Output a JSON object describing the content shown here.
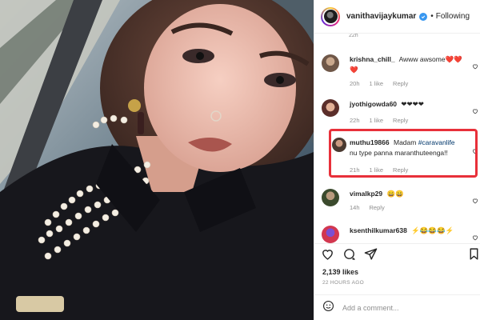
{
  "post": {
    "username": "vanithavijaykumar",
    "follow_status": "Following",
    "separator": "•",
    "likes": "2,139 likes",
    "time_ago": "22 HOURS AGO"
  },
  "comments_partial_meta": "22h",
  "comments": [
    {
      "user": "krishna_chill_",
      "text": "Awww awsome❤️❤️❤️",
      "time": "20h",
      "likes": "1 like",
      "reply": "Reply"
    },
    {
      "user": "jyothigowda60",
      "text": "❤❤❤❤",
      "time": "22h",
      "likes": "1 like",
      "reply": "Reply"
    },
    {
      "user": "muthu19866",
      "text_before": "Madam",
      "hashtag": "#caravanlife",
      "text_after": "nu type panna maranthuteenga!!",
      "time": "21h",
      "likes": "1 like",
      "reply": "Reply"
    },
    {
      "user": "vimalkp29",
      "text": "😄😄",
      "time": "14h",
      "reply": "Reply"
    },
    {
      "user": "ksenthilkumar638",
      "text": "⚡😂😂😂⚡"
    }
  ],
  "add_comment": {
    "placeholder": "Add a comment..."
  },
  "colors": {
    "highlight": "#e8303a",
    "link": "#00376b",
    "verified": "#3897f0"
  },
  "icons": [
    "heart-icon",
    "comment-icon",
    "share-icon",
    "bookmark-icon",
    "emoji-icon",
    "verified-icon"
  ]
}
